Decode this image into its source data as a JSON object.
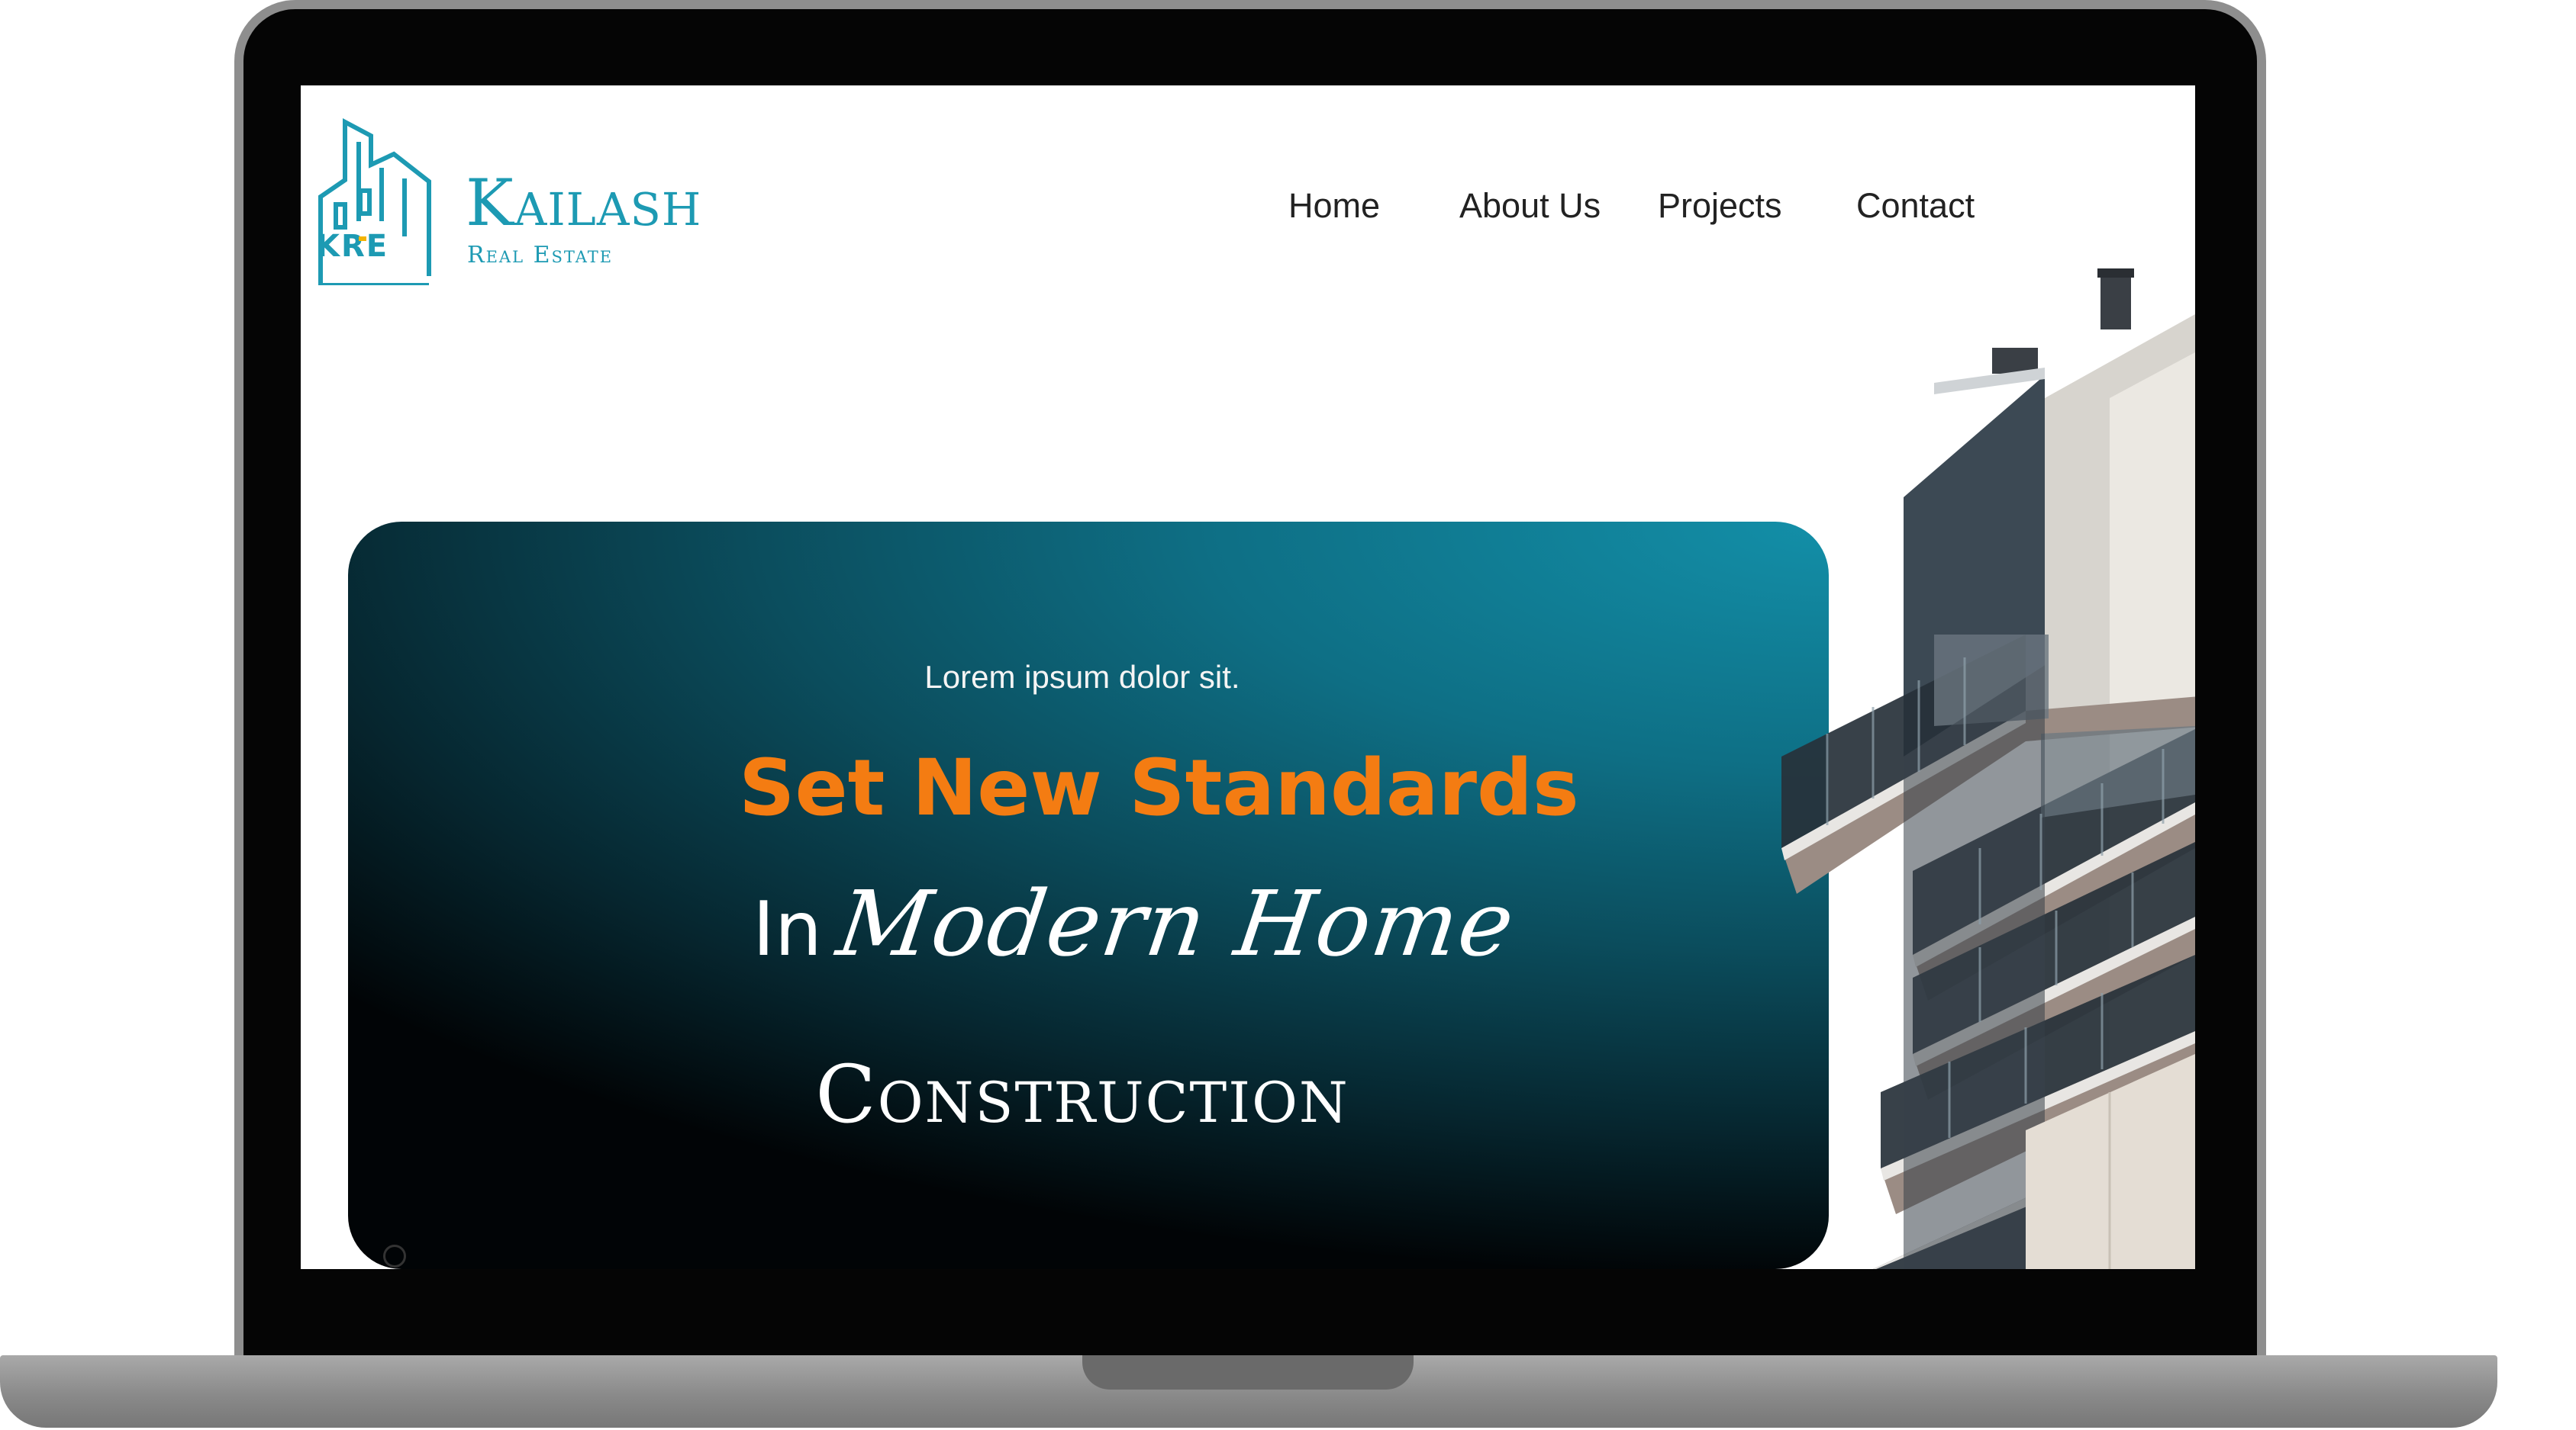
{
  "brand": {
    "name": "Kailash",
    "subtitle": "Real Estate",
    "logo_letters": "KRE",
    "color": "#1d9ab3"
  },
  "nav": {
    "items": [
      {
        "label": "Home"
      },
      {
        "label": "About Us"
      },
      {
        "label": "Projects"
      },
      {
        "label": "Contact"
      }
    ]
  },
  "hero": {
    "kicker": "Lorem ipsum dolor sit.",
    "headline": "Set New Standards",
    "line2_prefix": "In",
    "line2_script": "Modern Home",
    "line3": "Construction",
    "headline_color": "#f47c12",
    "gradient_colors": [
      "#138fa8",
      "#0b4d5d",
      "#010406"
    ]
  },
  "icons": [
    "building-logo-icon",
    "building-photo-image",
    "scroll-indicator-icon"
  ]
}
